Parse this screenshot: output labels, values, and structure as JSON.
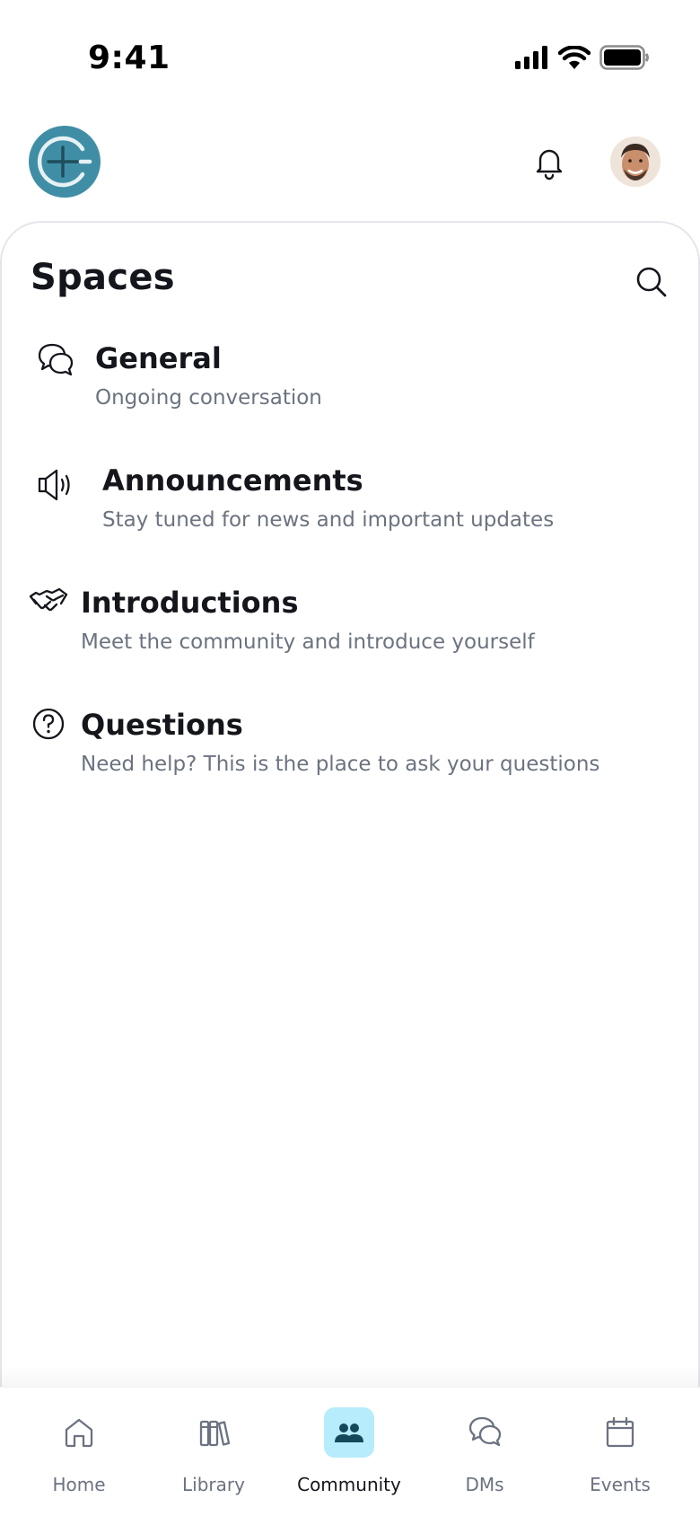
{
  "status_bar": {
    "time": "9:41",
    "icons": [
      "cellular-signal-icon",
      "wifi-icon",
      "battery-icon"
    ]
  },
  "header": {
    "logo": "community-logo-icon",
    "notification_icon": "bell-icon",
    "avatar": "user-avatar"
  },
  "spaces": {
    "title": "Spaces",
    "search_icon": "search-icon",
    "items": [
      {
        "name": "General",
        "description": "Ongoing conversation",
        "icon": "chat-bubbles-icon"
      },
      {
        "name": "Announcements",
        "description": "Stay tuned for news and important updates",
        "icon": "megaphone-icon"
      },
      {
        "name": "Introductions",
        "description": "Meet the community and introduce yourself",
        "icon": "handshake-icon"
      },
      {
        "name": "Questions",
        "description": "Need help? This is the place to ask your questions",
        "icon": "question-circle-icon"
      }
    ]
  },
  "bottom_nav": {
    "items": [
      {
        "label": "Home",
        "icon": "home-icon",
        "active": false
      },
      {
        "label": "Library",
        "icon": "library-icon",
        "active": false
      },
      {
        "label": "Community",
        "icon": "community-icon",
        "active": true
      },
      {
        "label": "DMs",
        "icon": "chat-bubbles-icon",
        "active": false
      },
      {
        "label": "Events",
        "icon": "calendar-icon",
        "active": false
      }
    ]
  },
  "colors": {
    "brand": "#3f8ea6",
    "active_nav_bg": "#b6ecfb",
    "text_primary": "#14161c",
    "text_secondary": "#6b7380"
  }
}
